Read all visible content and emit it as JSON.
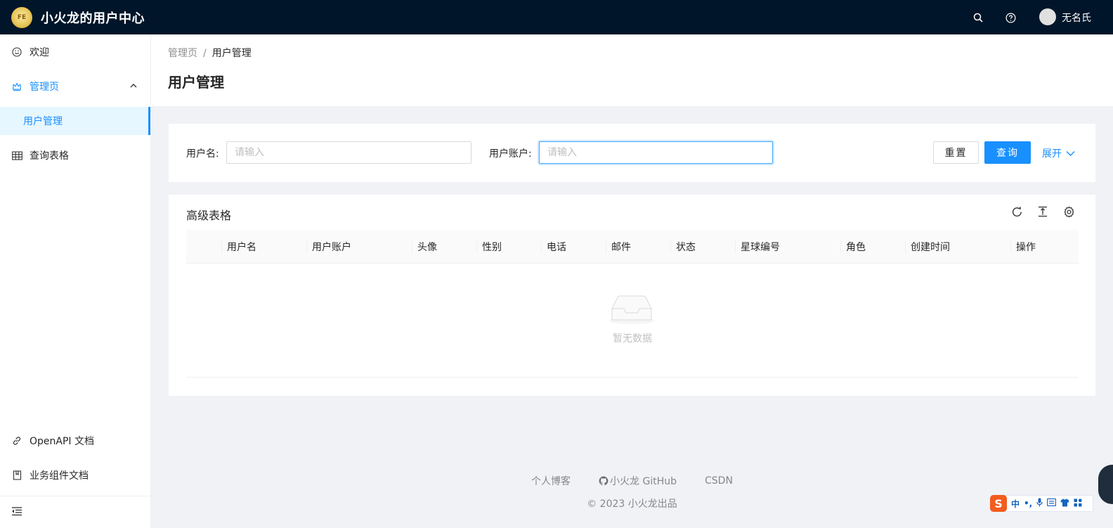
{
  "header": {
    "logo_text": "FE",
    "app_title": "小火龙的用户中心",
    "username": "无名氏"
  },
  "sidebar": {
    "items": [
      {
        "label": "欢迎",
        "icon": "smile-icon"
      },
      {
        "label": "管理页",
        "icon": "crown-icon"
      },
      {
        "label": "用户管理"
      },
      {
        "label": "查询表格",
        "icon": "table-icon"
      }
    ],
    "bottom_items": [
      {
        "label": "OpenAPI 文档",
        "icon": "link-icon"
      },
      {
        "label": "业务组件文档",
        "icon": "book-icon"
      }
    ]
  },
  "breadcrumb": {
    "root": "管理页",
    "separator": "/",
    "current": "用户管理"
  },
  "page": {
    "title": "用户管理"
  },
  "search": {
    "username_label": "用户名:",
    "username_placeholder": "请输入",
    "account_label": "用户账户:",
    "account_placeholder": "请输入",
    "reset_label": "重置",
    "query_label": "查询",
    "expand_label": "展开"
  },
  "table": {
    "title": "高级表格",
    "columns": [
      "用户名",
      "用户账户",
      "头像",
      "性别",
      "电话",
      "邮件",
      "状态",
      "星球编号",
      "角色",
      "创建时间",
      "操作"
    ],
    "empty_text": "暂无数据"
  },
  "footer": {
    "links": [
      "个人博客",
      "小火龙 GitHub",
      "CSDN"
    ],
    "copyright": "2023 小火龙出品"
  },
  "ime": {
    "logo": "S",
    "lang": "中"
  },
  "colors": {
    "header_bg": "#001529",
    "primary": "#1890ff",
    "selected_bg": "#e6f7ff",
    "page_bg": "#f0f2f5"
  }
}
